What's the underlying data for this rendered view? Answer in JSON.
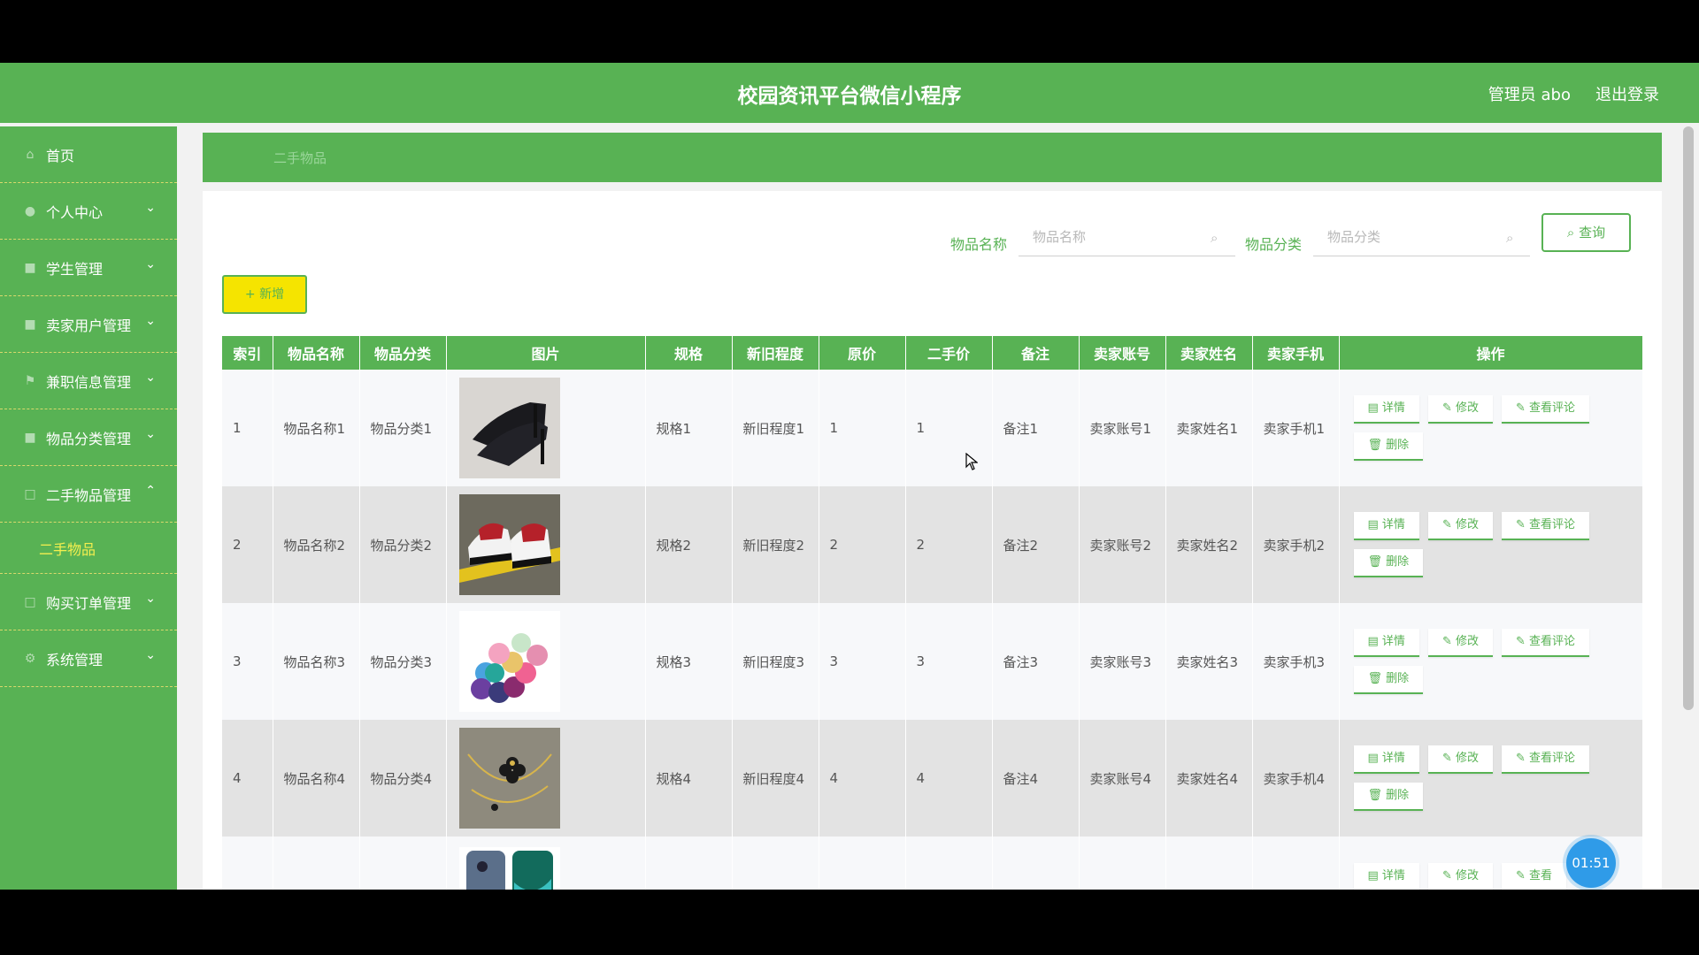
{
  "header": {
    "title": "校园资讯平台微信小程序",
    "admin": "管理员 abo",
    "logout": "退出登录"
  },
  "sidebar": {
    "items": [
      {
        "label": "首页"
      },
      {
        "label": "个人中心"
      },
      {
        "label": "学生管理"
      },
      {
        "label": "卖家用户管理"
      },
      {
        "label": "兼职信息管理"
      },
      {
        "label": "物品分类管理"
      },
      {
        "label": "二手物品管理"
      },
      {
        "label": "购买订单管理"
      },
      {
        "label": "系统管理"
      }
    ],
    "sub_active": "二手物品"
  },
  "breadcrumb": "二手物品",
  "search": {
    "name_label": "物品名称",
    "name_placeholder": "物品名称",
    "category_label": "物品分类",
    "category_placeholder": "物品分类",
    "query_label": "查询"
  },
  "toolbar": {
    "add_label": "+ 新增"
  },
  "table": {
    "headers": [
      "索引",
      "物品名称",
      "物品分类",
      "图片",
      "规格",
      "新旧程度",
      "原价",
      "二手价",
      "备注",
      "卖家账号",
      "卖家姓名",
      "卖家手机",
      "操作"
    ],
    "rows": [
      {
        "index": "1",
        "name": "物品名称1",
        "category": "物品分类1",
        "spec": "规格1",
        "condition": "新旧程度1",
        "price": "1",
        "used_price": "1",
        "note": "备注1",
        "account": "卖家账号1",
        "seller": "卖家姓名1",
        "phone": "卖家手机1",
        "image": "black-heels"
      },
      {
        "index": "2",
        "name": "物品名称2",
        "category": "物品分类2",
        "spec": "规格2",
        "condition": "新旧程度2",
        "price": "2",
        "used_price": "2",
        "note": "备注2",
        "account": "卖家账号2",
        "seller": "卖家姓名2",
        "phone": "卖家手机2",
        "image": "sneakers"
      },
      {
        "index": "3",
        "name": "物品名称3",
        "category": "物品分类3",
        "spec": "规格3",
        "condition": "新旧程度3",
        "price": "3",
        "used_price": "3",
        "note": "备注3",
        "account": "卖家账号3",
        "seller": "卖家姓名3",
        "phone": "卖家手机3",
        "image": "yoga-mats"
      },
      {
        "index": "4",
        "name": "物品名称4",
        "category": "物品分类4",
        "spec": "规格4",
        "condition": "新旧程度4",
        "price": "4",
        "used_price": "4",
        "note": "备注4",
        "account": "卖家账号4",
        "seller": "卖家姓名4",
        "phone": "卖家手机4",
        "image": "necklace"
      }
    ],
    "partial_row_actions": [
      "详情",
      "修改",
      "查看"
    ],
    "actions": {
      "detail": "详情",
      "edit": "修改",
      "comments": "查看评论",
      "delete": "删除"
    }
  },
  "timer": "01:51",
  "colors": {
    "primary": "#58b254",
    "accent": "#f5e400"
  }
}
